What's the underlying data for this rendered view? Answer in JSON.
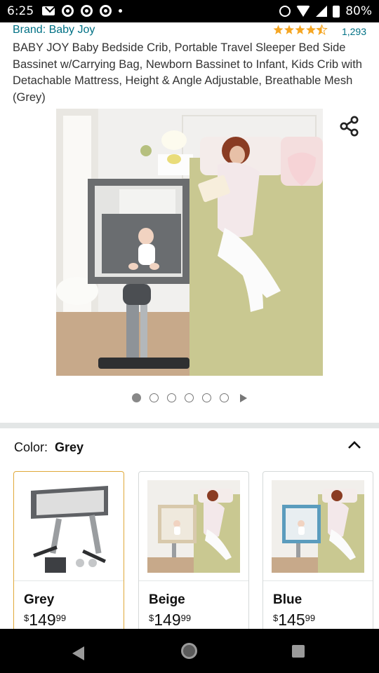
{
  "status_bar": {
    "time": "6:25",
    "battery": "80%",
    "icons": [
      "mail-icon",
      "chrome-icon",
      "chrome-icon",
      "chrome-icon",
      "dot-icon",
      "alarm-icon",
      "wifi-icon",
      "signal-icon",
      "battery-icon"
    ]
  },
  "product": {
    "brand": "Brand: Baby Joy",
    "rating_stars": "★★★★★",
    "rating": 4.5,
    "rating_count": "1,293",
    "title": "BABY JOY Baby Bedside Crib, Portable Travel Sleeper Bed Side Bassinet w/Carrying Bag, Newborn Bassinet to Infant, Kids Crib with Detachable Mattress, Height & Angle Adjustable, Breathable Mesh (Grey)"
  },
  "gallery": {
    "image_count": 6,
    "active_index": 0
  },
  "color_selector": {
    "label": "Color:",
    "selected": "Grey"
  },
  "swatches": [
    {
      "name": "Grey",
      "currency": "$",
      "whole": "149",
      "fraction": "99",
      "selected": true
    },
    {
      "name": "Beige",
      "currency": "$",
      "whole": "149",
      "fraction": "99",
      "selected": false
    },
    {
      "name": "Blue",
      "currency": "$",
      "whole": "145",
      "fraction": "99",
      "selected": false
    }
  ],
  "colors": {
    "link": "#007185",
    "star": "#f5a623",
    "selected_border": "#e0a93a",
    "sheet": "#c9c891"
  }
}
